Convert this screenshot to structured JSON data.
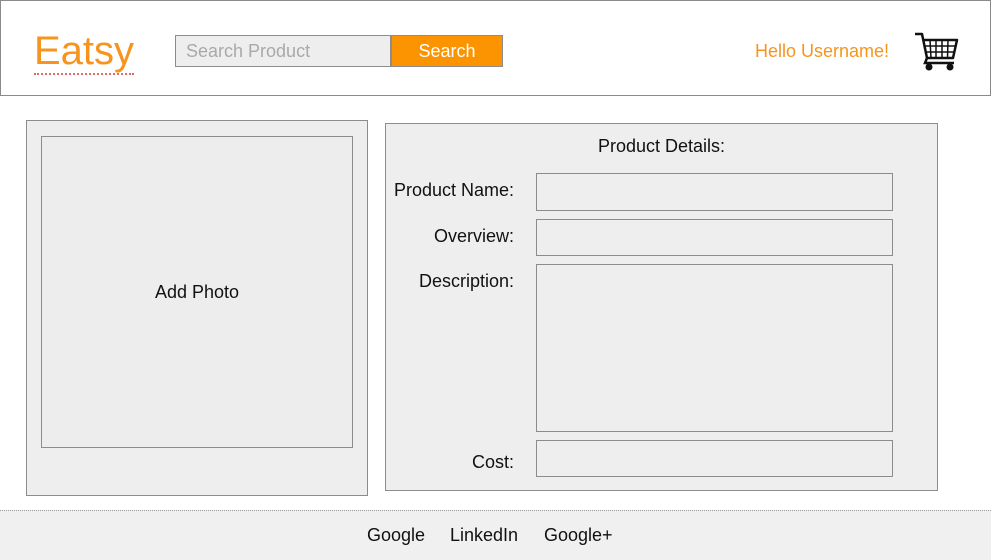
{
  "header": {
    "logo": "Eatsy",
    "search": {
      "placeholder": "Search Product",
      "value": "",
      "button_label": "Search"
    },
    "greeting": "Hello Username!"
  },
  "photo": {
    "label": "Add Photo"
  },
  "details": {
    "title": "Product Details:",
    "fields": {
      "name": {
        "label": "Product Name:",
        "value": ""
      },
      "overview": {
        "label": "Overview:",
        "value": ""
      },
      "description": {
        "label": "Description:",
        "value": ""
      },
      "cost": {
        "label": "Cost:",
        "value": ""
      }
    }
  },
  "footer": {
    "links": [
      "Google",
      "LinkedIn",
      "Google+"
    ]
  },
  "colors": {
    "accent": "#f7941d",
    "button": "#fb9400",
    "panel": "#eeeeee",
    "border": "#8c8c8c"
  },
  "icons": {
    "cart": "shopping-cart-icon"
  }
}
